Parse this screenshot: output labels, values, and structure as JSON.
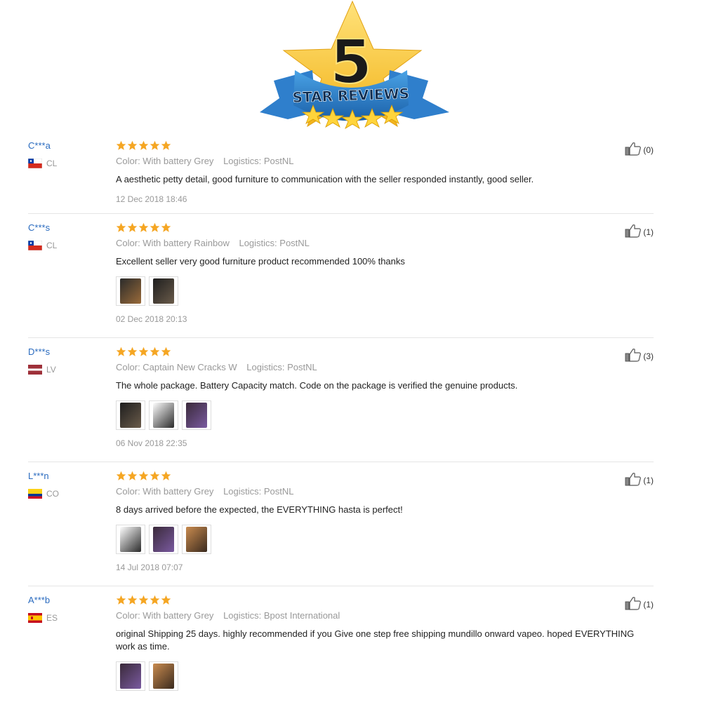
{
  "badge": {
    "number": "5",
    "banner_text": "STAR REVIEWS"
  },
  "reviews": [
    {
      "user": "C***a",
      "country": "CL",
      "rating": 5,
      "color": "Color: With battery Grey",
      "logistics": "Logistics: PostNL",
      "text": "A aesthetic petty detail, good furniture to communication with the seller responded instantly, good seller.",
      "photos": [],
      "date": "12 Dec 2018 18:46",
      "helpful": "(0)"
    },
    {
      "user": "C***s",
      "country": "CL",
      "rating": 5,
      "color": "Color: With battery Rainbow",
      "logistics": "Logistics: PostNL",
      "text": "Excellent seller very good furniture product recommended 100% thanks",
      "photos": [
        "photo-1",
        "photo-2"
      ],
      "date": "02 Dec 2018 20:13",
      "helpful": "(1)"
    },
    {
      "user": "D***s",
      "country": "LV",
      "rating": 5,
      "color": "Color: Captain New Cracks W",
      "logistics": "Logistics: PostNL",
      "text": "The whole package. Battery Capacity match. Code on the package is verified the genuine products.",
      "photos": [
        "photo-1",
        "photo-2",
        "photo-3"
      ],
      "date": "06 Nov 2018 22:35",
      "helpful": "(3)"
    },
    {
      "user": "L***n",
      "country": "CO",
      "rating": 5,
      "color": "Color: With battery Grey",
      "logistics": "Logistics: PostNL",
      "text": "8 days arrived before the expected, the EVERYTHING hasta is perfect!",
      "photos": [
        "photo-1",
        "photo-2",
        "photo-3"
      ],
      "date": "14 Jul 2018 07:07",
      "helpful": "(1)"
    },
    {
      "user": "A***b",
      "country": "ES",
      "rating": 5,
      "color": "Color: With battery Grey",
      "logistics": "Logistics: Bpost International",
      "text": "original Shipping 25 days. highly recommended if you Give one step free shipping mundillo onward vapeo. hoped EVERYTHING work as time.",
      "photos": [
        "photo-1",
        "photo-2"
      ],
      "date": "",
      "helpful": "(1)"
    }
  ],
  "colors": {
    "star": "#f5a623",
    "user_link": "#2a6bbf",
    "meta_text": "#999999",
    "divider": "#e5e5e5"
  }
}
